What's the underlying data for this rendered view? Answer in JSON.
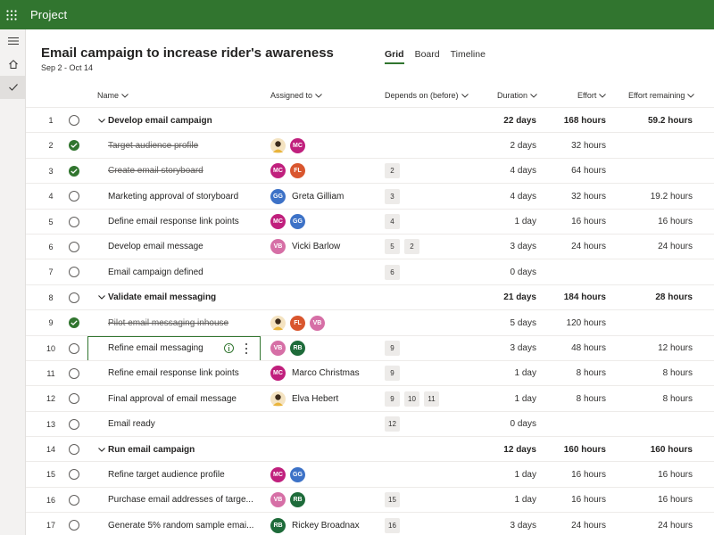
{
  "app": {
    "title": "Project"
  },
  "project": {
    "title": "Email campaign to increase rider's awareness",
    "dates": "Sep 2 - Oct 14"
  },
  "views": [
    {
      "label": "Grid",
      "active": true
    },
    {
      "label": "Board",
      "active": false
    },
    {
      "label": "Timeline",
      "active": false
    }
  ],
  "columns": {
    "name": "Name",
    "assigned": "Assigned to",
    "depends": "Depends on (before)",
    "duration": "Duration",
    "effort": "Effort",
    "remaining": "Effort remaining"
  },
  "colors": {
    "brand": "#31752f",
    "avatar_MC": "#c0207d",
    "avatar_FL": "#d9562e",
    "avatar_GG": "#3d72c7",
    "avatar_VB": "#d66fa6",
    "avatar_RB": "#1e6b3a",
    "avatar_photo": "#e9b43b"
  },
  "rows": [
    {
      "num": "1",
      "type": "summary",
      "done": false,
      "name": "Develop email campaign",
      "assignees": [],
      "assignee_name": "",
      "deps": [],
      "duration": "22 days",
      "effort": "168 hours",
      "remaining": "59.2 hours"
    },
    {
      "num": "2",
      "type": "task",
      "done": true,
      "name": "Target audience profile",
      "assignees": [
        {
          "initials": "",
          "color": "#e9b43b",
          "photo": true
        },
        {
          "initials": "MC",
          "color": "#c0207d"
        }
      ],
      "assignee_name": "",
      "deps": [],
      "duration": "2 days",
      "effort": "32 hours",
      "remaining": ""
    },
    {
      "num": "3",
      "type": "task",
      "done": true,
      "name": "Create email storyboard",
      "assignees": [
        {
          "initials": "MC",
          "color": "#c0207d"
        },
        {
          "initials": "FL",
          "color": "#d9562e"
        }
      ],
      "assignee_name": "",
      "deps": [
        "2"
      ],
      "duration": "4 days",
      "effort": "64 hours",
      "remaining": ""
    },
    {
      "num": "4",
      "type": "task",
      "done": false,
      "name": "Marketing approval of storyboard",
      "assignees": [
        {
          "initials": "GG",
          "color": "#3d72c7"
        }
      ],
      "assignee_name": "Greta Gilliam",
      "deps": [
        "3"
      ],
      "duration": "4 days",
      "effort": "32 hours",
      "remaining": "19.2 hours"
    },
    {
      "num": "5",
      "type": "task",
      "done": false,
      "name": "Define email response link points",
      "assignees": [
        {
          "initials": "MC",
          "color": "#c0207d"
        },
        {
          "initials": "GG",
          "color": "#3d72c7"
        }
      ],
      "assignee_name": "",
      "deps": [
        "4"
      ],
      "duration": "1 day",
      "effort": "16 hours",
      "remaining": "16 hours"
    },
    {
      "num": "6",
      "type": "task",
      "done": false,
      "name": "Develop email message",
      "assignees": [
        {
          "initials": "VB",
          "color": "#d66fa6"
        }
      ],
      "assignee_name": "Vicki Barlow",
      "deps": [
        "5",
        "2"
      ],
      "duration": "3 days",
      "effort": "24 hours",
      "remaining": "24 hours"
    },
    {
      "num": "7",
      "type": "task",
      "done": false,
      "name": "Email campaign defined",
      "assignees": [],
      "assignee_name": "",
      "deps": [
        "6"
      ],
      "duration": "0 days",
      "effort": "",
      "remaining": ""
    },
    {
      "num": "8",
      "type": "summary",
      "done": false,
      "name": "Validate email messaging",
      "assignees": [],
      "assignee_name": "",
      "deps": [],
      "duration": "21 days",
      "effort": "184 hours",
      "remaining": "28 hours"
    },
    {
      "num": "9",
      "type": "task",
      "done": true,
      "name": "Pilot email messaging inhouse",
      "assignees": [
        {
          "initials": "",
          "color": "#e9b43b",
          "photo": true
        },
        {
          "initials": "FL",
          "color": "#d9562e"
        },
        {
          "initials": "VB",
          "color": "#d66fa6"
        }
      ],
      "assignee_name": "",
      "deps": [],
      "duration": "5 days",
      "effort": "120 hours",
      "remaining": ""
    },
    {
      "num": "10",
      "type": "task",
      "done": false,
      "selected": true,
      "name": "Refine email messaging",
      "assignees": [
        {
          "initials": "VB",
          "color": "#d66fa6"
        },
        {
          "initials": "RB",
          "color": "#1e6b3a"
        }
      ],
      "assignee_name": "",
      "deps": [
        "9"
      ],
      "duration": "3 days",
      "effort": "48 hours",
      "remaining": "12 hours"
    },
    {
      "num": "11",
      "type": "task",
      "done": false,
      "name": "Refine email response link points",
      "assignees": [
        {
          "initials": "MC",
          "color": "#c0207d"
        }
      ],
      "assignee_name": "Marco Christmas",
      "deps": [
        "9"
      ],
      "duration": "1 day",
      "effort": "8 hours",
      "remaining": "8 hours"
    },
    {
      "num": "12",
      "type": "task",
      "done": false,
      "name": "Final approval of email message",
      "assignees": [
        {
          "initials": "",
          "color": "#e9b43b",
          "photo": true
        }
      ],
      "assignee_name": "Elva Hebert",
      "deps": [
        "9",
        "10",
        "11"
      ],
      "duration": "1 day",
      "effort": "8 hours",
      "remaining": "8 hours"
    },
    {
      "num": "13",
      "type": "task",
      "done": false,
      "name": "Email ready",
      "assignees": [],
      "assignee_name": "",
      "deps": [
        "12"
      ],
      "duration": "0 days",
      "effort": "",
      "remaining": ""
    },
    {
      "num": "14",
      "type": "summary",
      "done": false,
      "name": "Run email campaign",
      "assignees": [],
      "assignee_name": "",
      "deps": [],
      "duration": "12 days",
      "effort": "160 hours",
      "remaining": "160 hours"
    },
    {
      "num": "15",
      "type": "task",
      "done": false,
      "name": "Refine target audience profile",
      "assignees": [
        {
          "initials": "MC",
          "color": "#c0207d"
        },
        {
          "initials": "GG",
          "color": "#3d72c7"
        }
      ],
      "assignee_name": "",
      "deps": [],
      "duration": "1 day",
      "effort": "16 hours",
      "remaining": "16 hours"
    },
    {
      "num": "16",
      "type": "task",
      "done": false,
      "name": "Purchase email addresses of targe...",
      "assignees": [
        {
          "initials": "VB",
          "color": "#d66fa6"
        },
        {
          "initials": "RB",
          "color": "#1e6b3a"
        }
      ],
      "assignee_name": "",
      "deps": [
        "15"
      ],
      "duration": "1 day",
      "effort": "16 hours",
      "remaining": "16 hours"
    },
    {
      "num": "17",
      "type": "task",
      "done": false,
      "name": "Generate 5% random sample emai...",
      "assignees": [
        {
          "initials": "RB",
          "color": "#1e6b3a"
        }
      ],
      "assignee_name": "Rickey Broadnax",
      "deps": [
        "16"
      ],
      "duration": "3 days",
      "effort": "24 hours",
      "remaining": "24 hours"
    }
  ]
}
